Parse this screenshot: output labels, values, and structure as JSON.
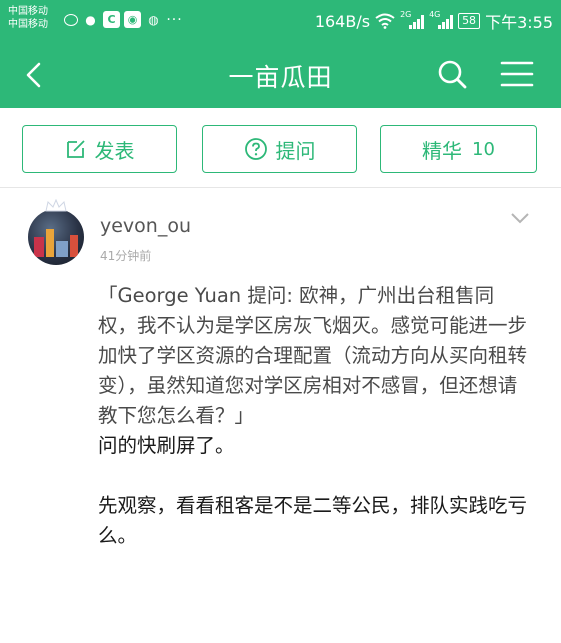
{
  "status_bar": {
    "carrier_1": "中国移动",
    "carrier_2": "中国移动",
    "more_dots": "···",
    "net_speed": "164B/s",
    "sig1_tag": "2G",
    "sig2_tag": "4G",
    "battery": "58",
    "clock": "下午3:55"
  },
  "app_bar": {
    "title": "一亩瓜田"
  },
  "actions": {
    "post_label": "发表",
    "ask_label": "提问",
    "featured_label": "精华",
    "featured_count": "10"
  },
  "post": {
    "username": "yevon_ou",
    "time": "41分钟前",
    "quote": "「George Yuan 提问: 欧神，广州出台租售同权，我不认为是学区房灰飞烟灭。感觉可能进一步加快了学区资源的合理配置（流动方向从买向租转变），虽然知道您对学区房相对不感冒，但还想请教下您怎么看？」",
    "reply_1": "问的快刷屏了。",
    "reply_2": "先观察，看看租客是不是二等公民，排队实践吃亏么。"
  },
  "colors": {
    "brand_green": "#2db878"
  },
  "icons": {
    "back": "back-arrow-icon",
    "search": "search-icon",
    "menu": "hamburger-menu-icon",
    "post": "edit-icon",
    "ask": "question-icon",
    "expand": "chevron-down-icon"
  }
}
